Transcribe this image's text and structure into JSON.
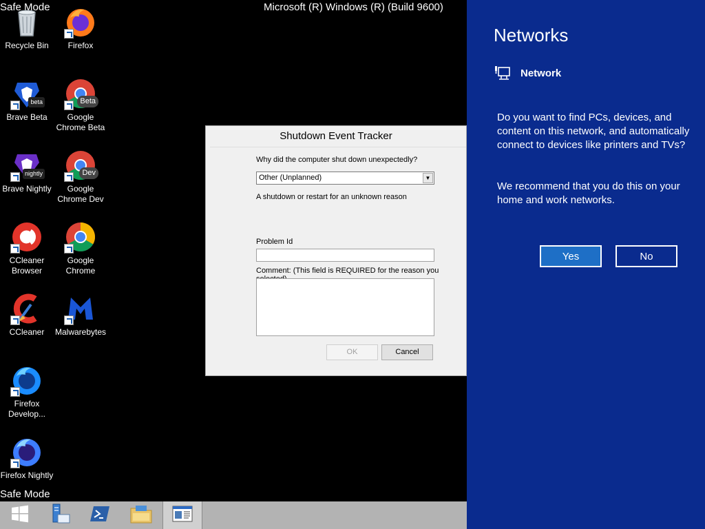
{
  "desktop": {
    "safe_mode_label": "Safe Mode",
    "build_text": "Microsoft (R) Windows (R) (Build 9600)",
    "icons": [
      {
        "label": "Recycle Bin",
        "icon": "recycle-bin-icon"
      },
      {
        "label": "Firefox",
        "icon": "firefox-icon"
      },
      {
        "label": "Brave Beta",
        "icon": "brave-icon",
        "badge": "beta"
      },
      {
        "label": "Google Chrome Beta",
        "icon": "chrome-icon",
        "badge": "Beta"
      },
      {
        "label": "Brave Nightly",
        "icon": "brave-icon",
        "badge": "nightly"
      },
      {
        "label": "Google Chrome Dev",
        "icon": "chrome-icon",
        "badge": "Dev"
      },
      {
        "label": "CCleaner Browser",
        "icon": "ccleaner-browser-icon"
      },
      {
        "label": "Google Chrome",
        "icon": "chrome-icon"
      },
      {
        "label": "CCleaner",
        "icon": "ccleaner-icon"
      },
      {
        "label": "Malwarebytes",
        "icon": "malwarebytes-icon"
      },
      {
        "label": "Firefox Develop...",
        "icon": "firefox-developer-icon"
      },
      {
        "label": "Firefox Nightly",
        "icon": "firefox-nightly-icon"
      }
    ]
  },
  "dialog": {
    "title": "Shutdown Event Tracker",
    "question": "Why did the computer shut down unexpectedly?",
    "selected_reason": "Other (Unplanned)",
    "reason_description": "A shutdown or restart for an unknown reason",
    "problem_id_label": "Problem Id",
    "problem_id_value": "",
    "comment_label": "Comment: (This field is REQUIRED for the reason you selected)",
    "comment_value": "",
    "ok_label": "OK",
    "cancel_label": "Cancel"
  },
  "networks": {
    "title": "Networks",
    "network_name": "Network",
    "question": "Do you want to find PCs, devices, and content on this network, and automatically connect to devices like printers and TVs?",
    "recommendation": "We recommend that you do this on your home and work networks.",
    "yes_label": "Yes",
    "no_label": "No"
  },
  "taskbar": {
    "items": [
      {
        "icon": "start-icon"
      },
      {
        "icon": "server-manager-icon"
      },
      {
        "icon": "powershell-icon"
      },
      {
        "icon": "file-explorer-icon"
      },
      {
        "icon": "shutdown-event-tracker-icon",
        "active": true
      }
    ]
  },
  "colors": {
    "networks_bg": "#0a2b8e",
    "yes_button": "#1e6fc6",
    "taskbar": "#b3b3b3"
  }
}
